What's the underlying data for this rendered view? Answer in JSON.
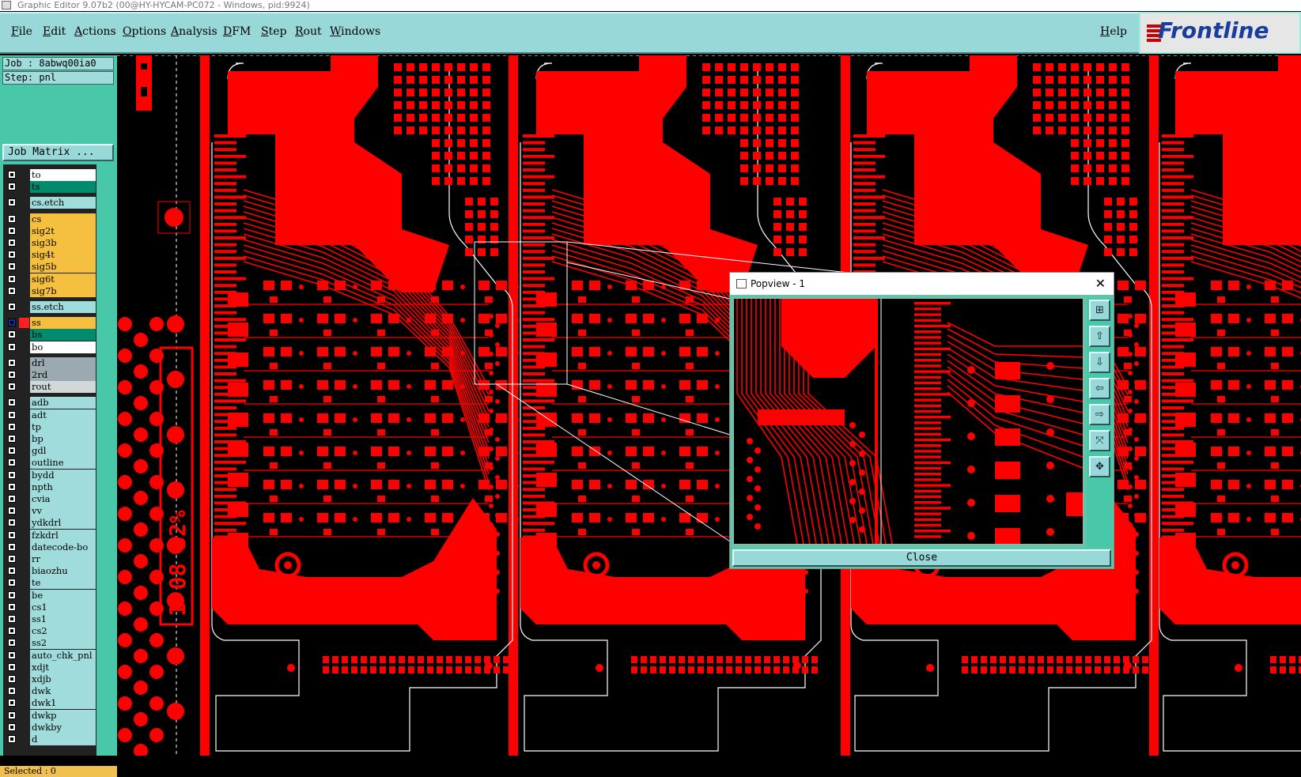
{
  "window": {
    "title": "Graphic Editor 9.07b2 (00@HY-HYCAM-PC072 - Windows, pid:9924)"
  },
  "menu": {
    "items": [
      "File",
      "Edit",
      "Actions",
      "Options",
      "Analysis",
      "DFM",
      "Step",
      "Rout",
      "Windows"
    ],
    "help": "Help"
  },
  "logo": {
    "text": "Frontline"
  },
  "job": {
    "job_line": "Job : 8abwq00ia0",
    "step_line": "Step: pnl",
    "matrix_button": "Job Matrix ..."
  },
  "layers": [
    {
      "name": "to",
      "color": "#ffffff"
    },
    {
      "name": "ts",
      "color": "#008c6c"
    },
    {
      "name": "cs.etch",
      "color": "#a0dcdc"
    },
    {
      "name": "cs",
      "color": "#f5c040"
    },
    {
      "name": "sig2t",
      "color": "#f5c040"
    },
    {
      "name": "sig3b",
      "color": "#f5c040"
    },
    {
      "name": "sig4t",
      "color": "#f5c040"
    },
    {
      "name": "sig5b",
      "color": "#f5c040"
    },
    {
      "name": "sig6t",
      "color": "#f5c040"
    },
    {
      "name": "sig7b",
      "color": "#f5c040"
    },
    {
      "name": "ss.etch",
      "color": "#a0dcdc"
    },
    {
      "name": "ss",
      "color": "#f5c040",
      "active": true
    },
    {
      "name": "bs",
      "color": "#008c6c"
    },
    {
      "name": "bo",
      "color": "#ffffff"
    },
    {
      "name": "drl",
      "color": "#9aaab0"
    },
    {
      "name": "2rd",
      "color": "#9aaab0"
    },
    {
      "name": "rout",
      "color": "#d0d8d8"
    },
    {
      "name": "adb",
      "color": "#a0dcdc"
    },
    {
      "name": "adt",
      "color": "#a0dcdc"
    },
    {
      "name": "tp",
      "color": "#a0dcdc"
    },
    {
      "name": "bp",
      "color": "#a0dcdc"
    },
    {
      "name": "gdl",
      "color": "#a0dcdc"
    },
    {
      "name": "outline",
      "color": "#a0dcdc"
    },
    {
      "name": "bydd",
      "color": "#a0dcdc"
    },
    {
      "name": "npth",
      "color": "#a0dcdc"
    },
    {
      "name": "cvia",
      "color": "#a0dcdc"
    },
    {
      "name": "vv",
      "color": "#a0dcdc"
    },
    {
      "name": "ydkdrl",
      "color": "#a0dcdc"
    },
    {
      "name": "fzkdrl",
      "color": "#a0dcdc"
    },
    {
      "name": "datecode-bo",
      "color": "#a0dcdc"
    },
    {
      "name": "rr",
      "color": "#a0dcdc"
    },
    {
      "name": "biaozhu",
      "color": "#a0dcdc"
    },
    {
      "name": "te",
      "color": "#a0dcdc"
    },
    {
      "name": "be",
      "color": "#a0dcdc"
    },
    {
      "name": "cs1",
      "color": "#a0dcdc"
    },
    {
      "name": "ss1",
      "color": "#a0dcdc"
    },
    {
      "name": "cs2",
      "color": "#a0dcdc"
    },
    {
      "name": "ss2",
      "color": "#a0dcdc"
    },
    {
      "name": "auto_chk_pnl",
      "color": "#a0dcdc"
    },
    {
      "name": "xdjt",
      "color": "#a0dcdc"
    },
    {
      "name": "xdjb",
      "color": "#a0dcdc"
    },
    {
      "name": "dwk",
      "color": "#a0dcdc"
    },
    {
      "name": "dwk1",
      "color": "#a0dcdc"
    },
    {
      "name": "dwkp",
      "color": "#a0dcdc"
    },
    {
      "name": "dwkby",
      "color": "#a0dcdc"
    },
    {
      "name": "d",
      "color": "#a0dcdc"
    }
  ],
  "status": {
    "selected": "Selected : 0"
  },
  "popview": {
    "title": "Popview - 1",
    "close_button": "Close",
    "tools": [
      "zoom-box-icon",
      "pan-up-icon",
      "pan-down-icon",
      "pan-left-icon",
      "pan-right-icon",
      "zoom-out-icon",
      "fit-home-icon"
    ],
    "glyphs": [
      "⊞",
      "⇧",
      "⇩",
      "⇦",
      "⇨",
      "⤧",
      "✥"
    ]
  },
  "board": {
    "annotation": "1'08 32%",
    "trace_color": "#ff0000",
    "background": "#000000",
    "outline_color": "#ffffff"
  }
}
